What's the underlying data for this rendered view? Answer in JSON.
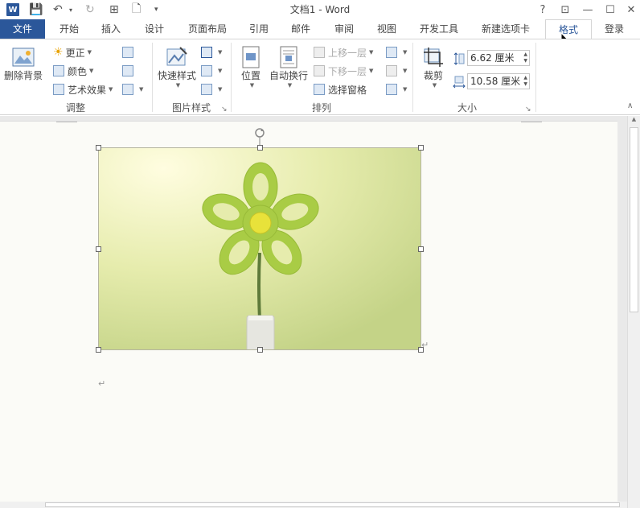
{
  "window": {
    "title": "文档1 - Word",
    "help": "?",
    "ribbon_display": "⊡",
    "minimize": "—",
    "maximize": "☐",
    "close": "✕"
  },
  "qat": {
    "logo": "W",
    "save": "💾",
    "undo": "↶",
    "redo": "↻",
    "touch": "⊞",
    "new": "🗋",
    "more": "▾"
  },
  "tabs": [
    "文件",
    "开始",
    "插入",
    "设计",
    "页面布局",
    "引用",
    "邮件",
    "审阅",
    "视图",
    "开发工具",
    "新建选项卡",
    "格式"
  ],
  "signin": "登录",
  "ribbon": {
    "adjust": {
      "label": "调整",
      "remove_bg": "删除背景",
      "corrections": "更正",
      "color": "颜色",
      "artistic": "艺术效果"
    },
    "picture_styles": {
      "label": "图片样式",
      "quick_styles": "快速样式"
    },
    "arrange": {
      "label": "排列",
      "position": "位置",
      "wrap_text": "自动换行",
      "bring_forward": "上移一层",
      "send_backward": "下移一层",
      "selection_pane": "选择窗格"
    },
    "size": {
      "label": "大小",
      "crop": "裁剪",
      "height": "6.62 厘米",
      "width": "10.58 厘米"
    }
  },
  "document": {
    "paragraph_mark": "↵"
  },
  "colors": {
    "accent": "#2b579a"
  }
}
